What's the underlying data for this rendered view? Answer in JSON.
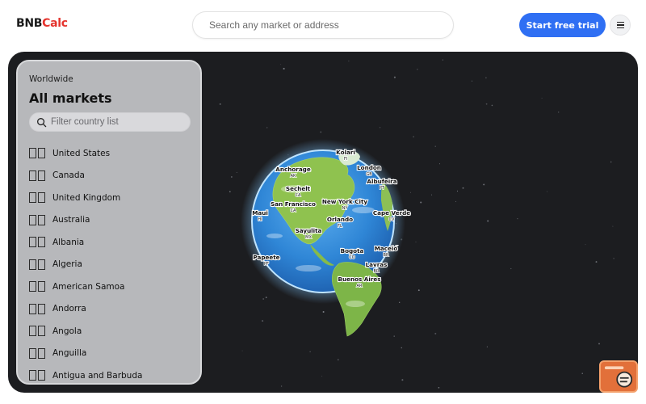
{
  "brand": {
    "part1": "BNB",
    "part2": "Calc",
    "accent": "#e5342e"
  },
  "header": {
    "search_placeholder": "Search any market or address",
    "cta_label": "Start free trial",
    "cta_color": "#2f6ff3",
    "menu_icon": "hamburger-menu-icon"
  },
  "panel": {
    "eyebrow": "Worldwide",
    "title": "All markets",
    "filter_placeholder": "Filter country list",
    "filter_icon": "search-icon",
    "countries": [
      "United States",
      "Canada",
      "United Kingdom",
      "Australia",
      "Albania",
      "Algeria",
      "American Samoa",
      "Andorra",
      "Angola",
      "Anguilla",
      "Antigua and Barbuda"
    ]
  },
  "map": {
    "markers": [
      {
        "city": "Kolari",
        "code": "FI"
      },
      {
        "city": "Anchorage",
        "code": "AK"
      },
      {
        "city": "London",
        "code": "GB"
      },
      {
        "city": "Sechelt",
        "code": "CA"
      },
      {
        "city": "Albufeira",
        "code": "PT"
      },
      {
        "city": "San Francisco",
        "code": "CA"
      },
      {
        "city": "New York City",
        "code": "NY"
      },
      {
        "city": "Maui",
        "code": "HI"
      },
      {
        "city": "Cape Verde",
        "code": "CV"
      },
      {
        "city": "Orlando",
        "code": "FL"
      },
      {
        "city": "Sayulita",
        "code": "MX"
      },
      {
        "city": "Papeete",
        "code": "PF"
      },
      {
        "city": "Bogota",
        "code": "CO"
      },
      {
        "city": "Maceió",
        "code": "BR"
      },
      {
        "city": "Lavras",
        "code": "BR"
      },
      {
        "city": "Buenos Aires",
        "code": "AR"
      }
    ]
  },
  "widget": {
    "icon": "chat-support-icon",
    "color": "#e2703a"
  }
}
